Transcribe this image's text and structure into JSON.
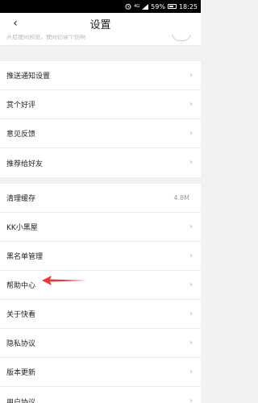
{
  "status_bar": {
    "alarm_icon": "alarm-icon",
    "network_badge": "4G",
    "battery": "59%",
    "time": "18:25"
  },
  "navbar": {
    "back_glyph": "‹",
    "title": "设置"
  },
  "cut_row": {
    "sub_text": "开启使间预览，使间仍读个伤啊"
  },
  "groups": [
    {
      "items": [
        {
          "label": "推送通知设置"
        },
        {
          "label": "赏个好评"
        },
        {
          "label": "意见反馈"
        },
        {
          "label": "推荐给好友"
        }
      ]
    },
    {
      "items": [
        {
          "label": "清理缓存",
          "value": "4.8M"
        },
        {
          "label": "KK小黑屋"
        },
        {
          "label": "黑名单管理"
        },
        {
          "label": "帮助中心"
        },
        {
          "label": "关于快看"
        },
        {
          "label": "隐私协议"
        },
        {
          "label": "版本更新"
        },
        {
          "label": "用户协议"
        }
      ]
    }
  ],
  "chevron_glyph": "›",
  "annotation": {
    "color": "#e53935"
  }
}
